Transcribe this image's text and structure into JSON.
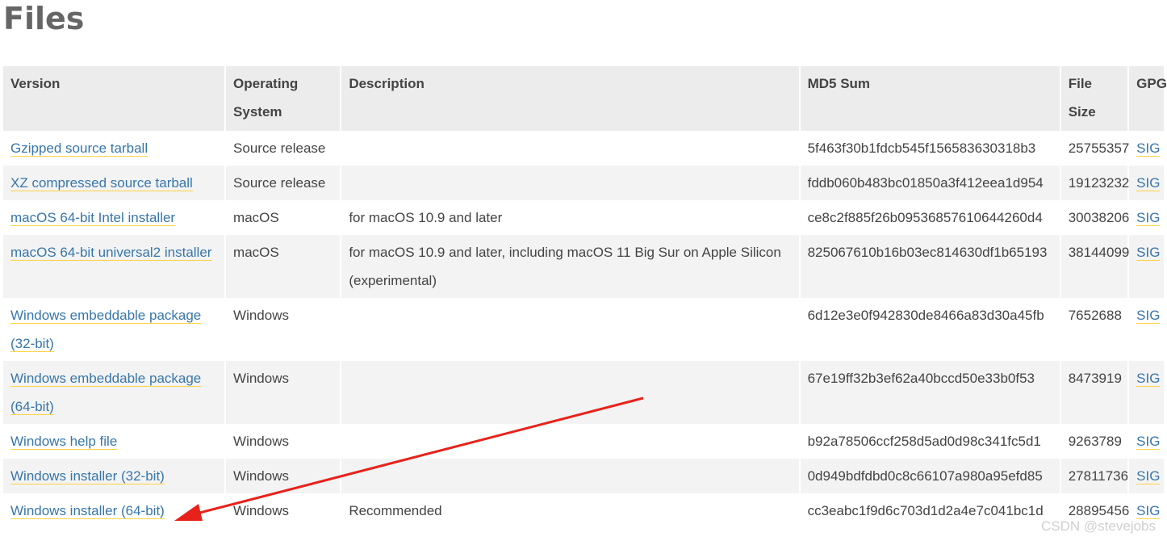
{
  "page": {
    "title": "Files"
  },
  "table": {
    "headers": {
      "version": "Version",
      "os": "Operating System",
      "description": "Description",
      "md5": "MD5 Sum",
      "size": "File Size",
      "gpg": "GPG"
    },
    "rows": [
      {
        "version": "Gzipped source tarball",
        "os": "Source release",
        "description": "",
        "md5": "5f463f30b1fdcb545f156583630318b3",
        "size": "25755357",
        "gpg": "SIG"
      },
      {
        "version": "XZ compressed source tarball",
        "os": "Source release",
        "description": "",
        "md5": "fddb060b483bc01850a3f412eea1d954",
        "size": "19123232",
        "gpg": "SIG"
      },
      {
        "version": "macOS 64-bit Intel installer",
        "os": "macOS",
        "description": "for macOS 10.9 and later",
        "md5": "ce8c2f885f26b09536857610644260d4",
        "size": "30038206",
        "gpg": "SIG"
      },
      {
        "version": "macOS 64-bit universal2 installer",
        "os": "macOS",
        "description": "for macOS 10.9 and later, including macOS 11 Big Sur on Apple Silicon (experimental)",
        "md5": "825067610b16b03ec814630df1b65193",
        "size": "38144099",
        "gpg": "SIG"
      },
      {
        "version": "Windows embeddable package (32-bit)",
        "os": "Windows",
        "description": "",
        "md5": "6d12e3e0f942830de8466a83d30a45fb",
        "size": "7652688",
        "gpg": "SIG"
      },
      {
        "version": "Windows embeddable package (64-bit)",
        "os": "Windows",
        "description": "",
        "md5": "67e19ff32b3ef62a40bccd50e33b0f53",
        "size": "8473919",
        "gpg": "SIG"
      },
      {
        "version": "Windows help file",
        "os": "Windows",
        "description": "",
        "md5": "b92a78506ccf258d5ad0d98c341fc5d1",
        "size": "9263789",
        "gpg": "SIG"
      },
      {
        "version": "Windows installer (32-bit)",
        "os": "Windows",
        "description": "",
        "md5": "0d949bdfdbd0c8c66107a980a95efd85",
        "size": "27811736",
        "gpg": "SIG"
      },
      {
        "version": "Windows installer (64-bit)",
        "os": "Windows",
        "description": "Recommended",
        "md5": "cc3eabc1f9d6c703d1d2a4e7c041bc1d",
        "size": "28895456",
        "gpg": "SIG"
      }
    ]
  },
  "watermark": "CSDN @stevejobs",
  "colors": {
    "link": "#3776ab",
    "link_underline": "#ffd343",
    "arrow": "#e8221b"
  }
}
